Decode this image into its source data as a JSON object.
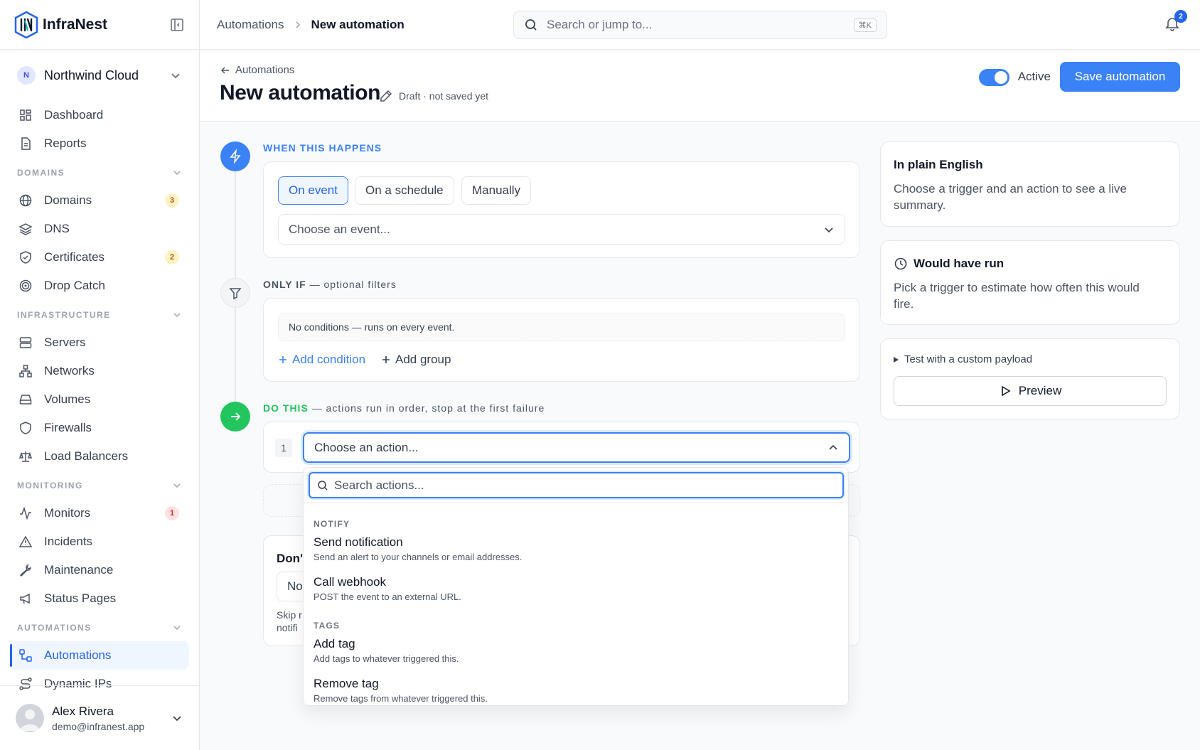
{
  "brand": {
    "name": "InfraNest"
  },
  "org": {
    "initial": "N",
    "name": "Northwind Cloud"
  },
  "nav": {
    "dashboard": "Dashboard",
    "reports": "Reports",
    "domains_section": "DOMAINS",
    "domains": "Domains",
    "domains_badge": "3",
    "dns": "DNS",
    "certificates": "Certificates",
    "certificates_badge": "2",
    "drop_catch": "Drop Catch",
    "infra_section": "INFRASTRUCTURE",
    "servers": "Servers",
    "networks": "Networks",
    "volumes": "Volumes",
    "firewalls": "Firewalls",
    "load_balancers": "Load Balancers",
    "monitoring_section": "MONITORING",
    "monitors": "Monitors",
    "monitors_badge": "1",
    "incidents": "Incidents",
    "maintenance": "Maintenance",
    "status_pages": "Status Pages",
    "automations_section": "AUTOMATIONS",
    "automations": "Automations",
    "dynamic_ips": "Dynamic IPs"
  },
  "user": {
    "name": "Alex Rivera",
    "email": "demo@infranest.app"
  },
  "topbar": {
    "crumb_parent": "Automations",
    "crumb_current": "New automation",
    "search_placeholder": "Search or jump to...",
    "search_shortcut": "⌘K",
    "notifications_count": "2"
  },
  "header": {
    "back_label": "Automations",
    "title": "New automation",
    "draft_status": "Draft · not saved yet",
    "active_label": "Active",
    "active": true,
    "save_label": "Save automation"
  },
  "trigger": {
    "label": "WHEN THIS HAPPENS",
    "modes": [
      "On event",
      "On a schedule",
      "Manually"
    ],
    "selected_mode": "On event",
    "event_placeholder": "Choose an event..."
  },
  "filters": {
    "label_strong": "ONLY IF",
    "label_rest": " — optional filters",
    "empty_text": "No conditions — runs on every event.",
    "add_condition": "Add condition",
    "add_group": "Add group"
  },
  "actions": {
    "label_strong": "DO THIS",
    "label_rest": " — actions run in order, stop at the first failure",
    "step_number": "1",
    "action_placeholder": "Choose an action..."
  },
  "dont": {
    "title_partial": "Don'",
    "input_partial": "No",
    "help_partial_1": "Skip r",
    "help_partial_2": "notifi"
  },
  "dropdown": {
    "search_placeholder": "Search actions...",
    "groups": [
      {
        "name": "NOTIFY",
        "items": [
          {
            "title": "Send notification",
            "desc": "Send an alert to your channels or email addresses."
          },
          {
            "title": "Call webhook",
            "desc": "POST the event to an external URL."
          }
        ]
      },
      {
        "name": "TAGS",
        "items": [
          {
            "title": "Add tag",
            "desc": "Add tags to whatever triggered this."
          },
          {
            "title": "Remove tag",
            "desc": "Remove tags from whatever triggered this."
          }
        ]
      }
    ]
  },
  "summary": {
    "title": "In plain English",
    "body": "Choose a trigger and an action to see a live summary."
  },
  "forecast": {
    "title": "Would have run",
    "body": "Pick a trigger to estimate how often this would fire."
  },
  "test": {
    "summary": "Test with a custom payload",
    "preview_label": "Preview"
  },
  "colors": {
    "accent": "#3b82f6",
    "success": "#22c55e",
    "warning_badge": "#b45309",
    "danger_badge": "#dc2626"
  }
}
